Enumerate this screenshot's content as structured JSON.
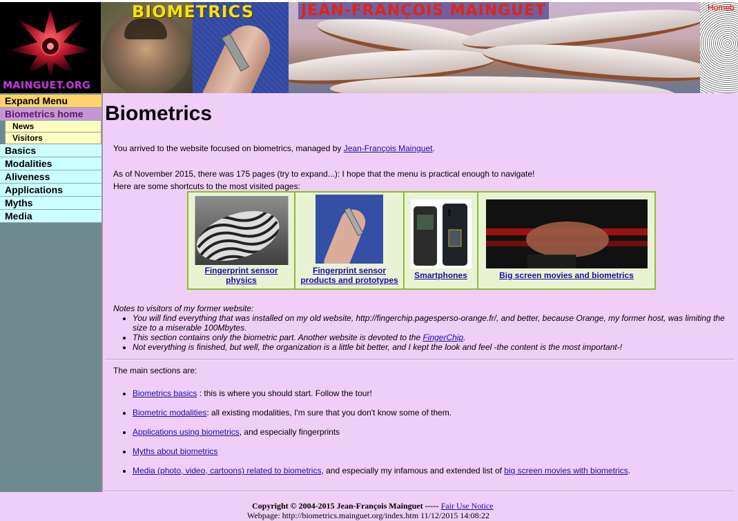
{
  "banner": {
    "logo_text": "MAINGUET.ORG",
    "brand_title": "BIOMETRICS",
    "author_title": "JEAN-FRANÇOIS MAINGUET",
    "home_link": "Homeb"
  },
  "sidebar": {
    "expand_menu": "Expand Menu",
    "home": "Biometrics home",
    "sub_items": [
      "News",
      "Visitors"
    ],
    "items": [
      "Basics",
      "Modalities",
      "Aliveness",
      "Applications",
      "Myths",
      "Media"
    ]
  },
  "main": {
    "title": "Biometrics",
    "intro_prefix": "You arrived to the website focused on biometrics, managed by ",
    "intro_link": "Jean-François Mainguet",
    "intro_suffix": ".",
    "pages_line": "As of November 2015, there was 175 pages (try to expand...): I hope that the menu is practical enough to navigate!",
    "shortcuts_intro": "Here are some shortcuts to the most visited pages:",
    "shortcuts": [
      {
        "line1": "Fingerprint sensor",
        "line2": "physics"
      },
      {
        "line1": "Fingerprint sensor",
        "line2": "products and prototypes"
      },
      {
        "line1": "Smartphones",
        "line2": ""
      },
      {
        "line1": "Big screen movies and biometrics",
        "line2": ""
      }
    ],
    "notes_heading": "Notes to visitors of my former website:",
    "notes": [
      {
        "text": "You will find everything that was installed on my old website, http://fingerchip.pagesperso-orange.fr/, and better, because Orange, my former host, was limiting the"
      },
      {
        "text": "size to a miserable 100Mbytes."
      },
      {
        "prefix": "This section contains only the biometric part. Another website is devoted to the ",
        "link": "FingerChip",
        "suffix": "."
      },
      {
        "text": "Not everything is finished, but well, the organization is a little bit better, and I kept the look and feel -the content is the most important-!"
      }
    ],
    "main_sections_heading": "The main sections are:",
    "sections": [
      {
        "link": "Biometrics basics",
        "text": " : this is where you should start. Follow the tour!"
      },
      {
        "link": "Biometric modalities",
        "text": ": all existing modalities, I'm sure that you don't know some of them."
      },
      {
        "link": "Applications using biometrics",
        "text": ", and especially fingerprints"
      },
      {
        "link": "Myths about biometrics",
        "text": ""
      },
      {
        "link": "Media (photo, video, cartoons) related to biometrics",
        "text": ", and especially my infamous and extended list of ",
        "link2": "big screen movies with biometrics",
        "text2": "."
      }
    ]
  },
  "footer": {
    "copyright": "Copyright © 2004-2015 Jean-François Mainguet -----",
    "fair_use": "Fair Use Notice",
    "webpage": "Webpage: http://biometrics.mainguet.org/index.htm 11/12/2015 14:08:22"
  },
  "colors": {
    "background": "#efcff7",
    "menu_expand": "#ffd36a",
    "menu_home": "#c696d4",
    "menu_item": "#ccffff",
    "link": "#1a0dab",
    "shortcut_border": "#8cbb33"
  }
}
